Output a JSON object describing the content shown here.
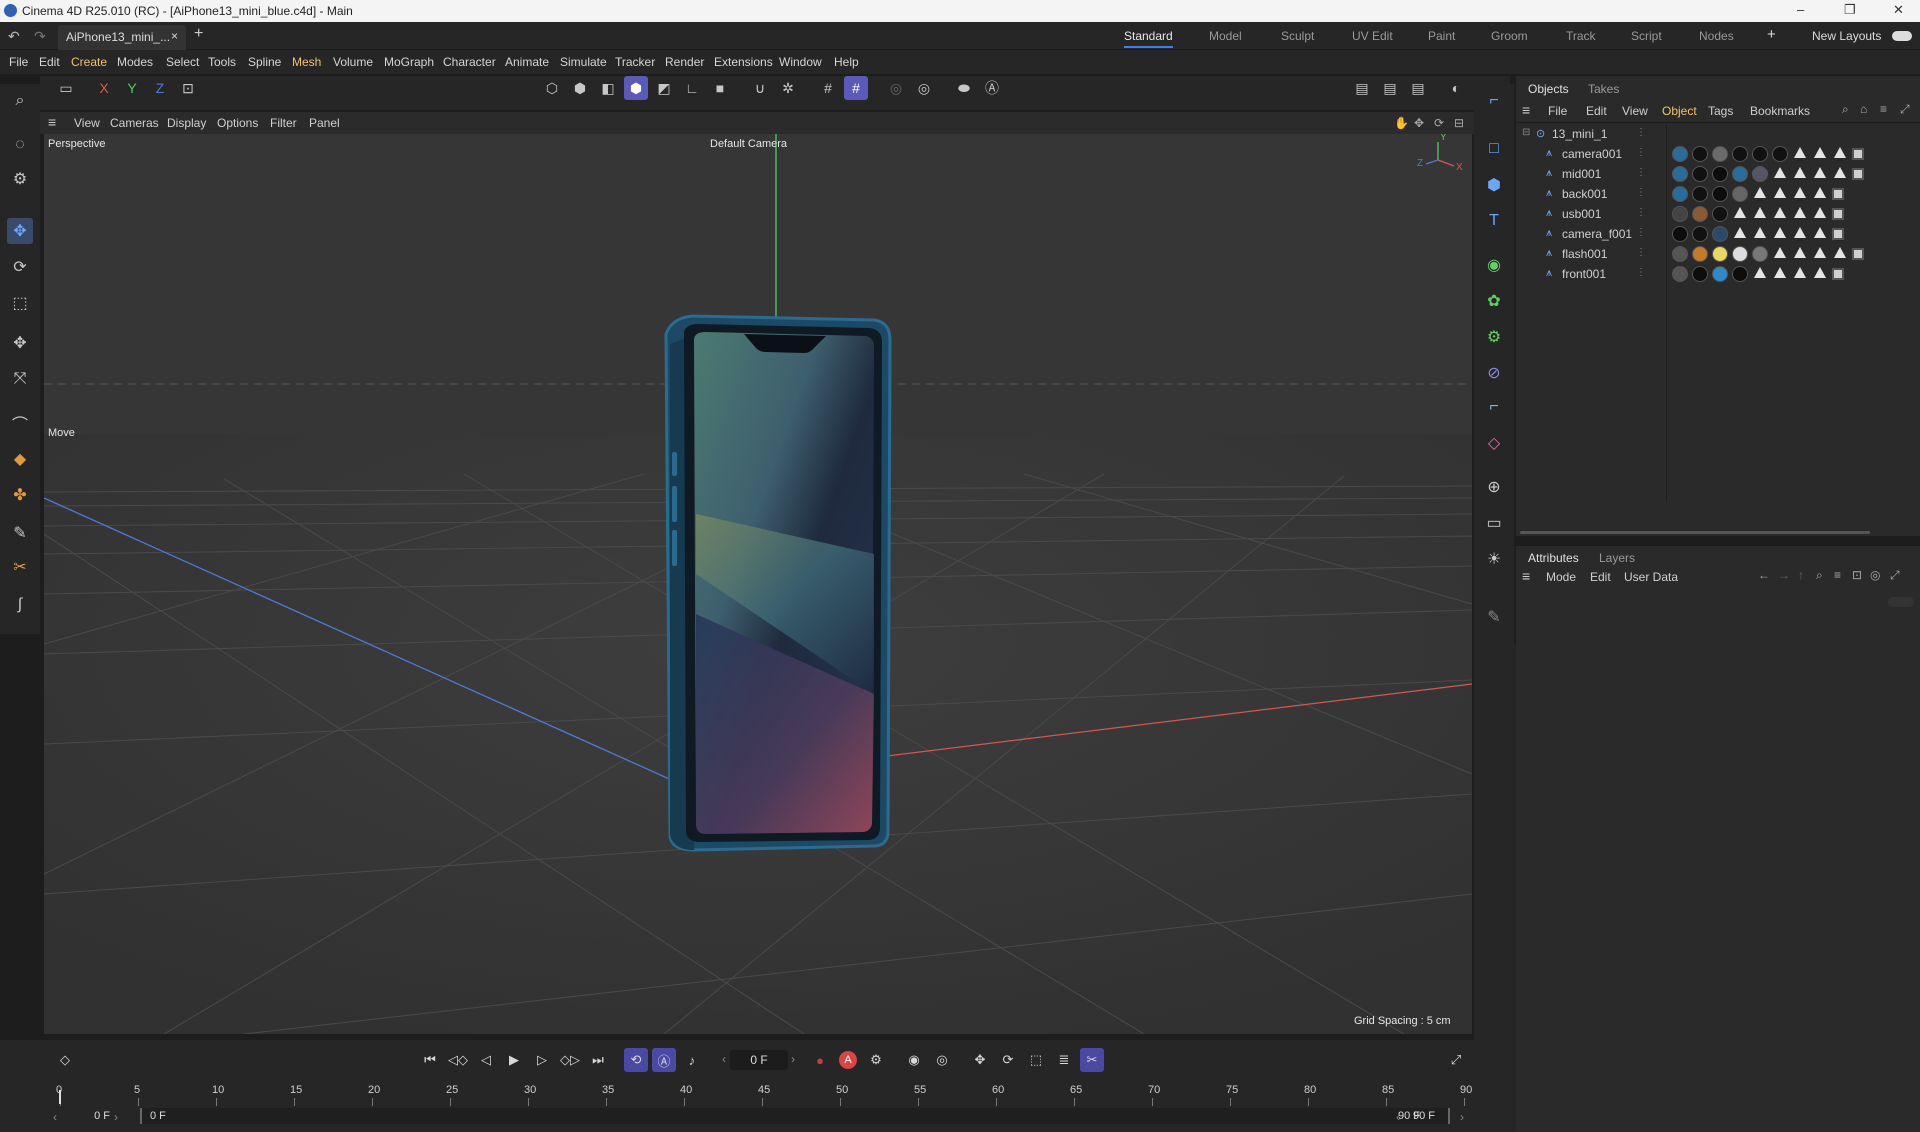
{
  "window": {
    "title": "Cinema 4D R25.010 (RC) - [AiPhone13_mini_blue.c4d] - Main",
    "minimize": "–",
    "restore": "❐",
    "close": "✕"
  },
  "tabs": {
    "document": "AiPhone13_mini_...",
    "close": "×",
    "add": "+"
  },
  "layouts": {
    "items": [
      "Standard",
      "Model",
      "Sculpt",
      "UV Edit",
      "Paint",
      "Groom",
      "Track",
      "Script",
      "Nodes"
    ],
    "add": "+",
    "new_layouts": "New Layouts"
  },
  "menu": [
    "File",
    "Edit",
    "Create",
    "Modes",
    "Select",
    "Tools",
    "Spline",
    "Mesh",
    "Volume",
    "MoGraph",
    "Character",
    "Animate",
    "Simulate",
    "Tracker",
    "Render",
    "Extensions",
    "Window",
    "Help"
  ],
  "axis_toggles": {
    "x": "X",
    "y": "Y",
    "z": "Z"
  },
  "viewport_menu": [
    "View",
    "Cameras",
    "Display",
    "Options",
    "Filter",
    "Panel"
  ],
  "viewport": {
    "label": "Perspective",
    "camera": "Default Camera",
    "move_label": "Move",
    "grid_spacing": "Grid Spacing : 5 cm",
    "axis_y": "Y",
    "axis_z": "Z",
    "axis_x": "X"
  },
  "objects_panel": {
    "tabs": [
      "Objects",
      "Takes"
    ],
    "menu": [
      "File",
      "Edit",
      "View",
      "Object",
      "Tags",
      "Bookmarks"
    ],
    "root": "13_mini_1",
    "items": [
      {
        "name": "camera001"
      },
      {
        "name": "mid001"
      },
      {
        "name": "back001"
      },
      {
        "name": "usb001"
      },
      {
        "name": "camera_f001"
      },
      {
        "name": "flash001"
      },
      {
        "name": "front001"
      }
    ]
  },
  "attributes_panel": {
    "tabs": [
      "Attributes",
      "Layers"
    ],
    "menu": [
      "Mode",
      "Edit",
      "User Data"
    ]
  },
  "timeline": {
    "current_frame": "0 F",
    "start": "0 F",
    "start2": "0 F",
    "end": "90 F",
    "end2": "90 F",
    "ruler": [
      "0",
      "5",
      "10",
      "15",
      "20",
      "25",
      "30",
      "35",
      "40",
      "45",
      "50",
      "55",
      "60",
      "65",
      "70",
      "75",
      "80",
      "85",
      "90"
    ]
  },
  "colors": {
    "accent": "#3d7ff0",
    "active_tool": "#5a5ab8",
    "menu_highlight": "#f4c46a",
    "x_axis": "#e0584c",
    "y_axis": "#4ad060",
    "z_axis": "#4d7ad8"
  }
}
